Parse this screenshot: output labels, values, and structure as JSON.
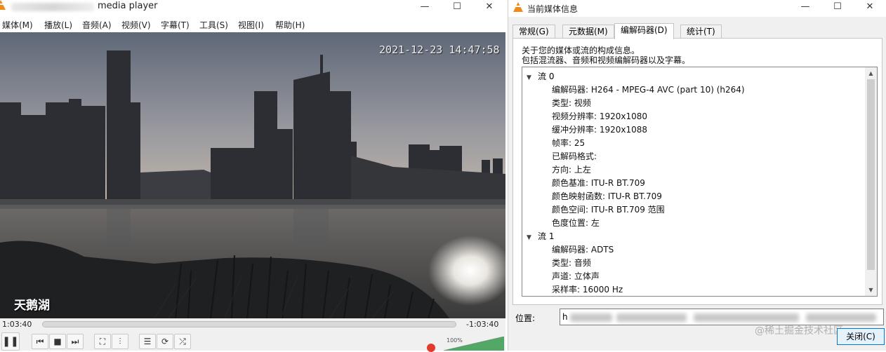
{
  "vlc": {
    "title": "media player",
    "window_controls": {
      "minimize": "—",
      "maximize": "☐",
      "close": "✕"
    },
    "menu": [
      "媒体(M)",
      "播放(L)",
      "音频(A)",
      "视频(V)",
      "字幕(T)",
      "工具(S)",
      "视图(I)",
      "帮助(H)"
    ],
    "video": {
      "timestamp": "2021-12-23 14:47:58",
      "caption": "天鹅湖"
    },
    "time_elapsed": "1:03:40",
    "time_remaining": "-1:03:40",
    "controls": {
      "play": "❚❚",
      "prev": "⏮",
      "stop": "■",
      "next": "⏭",
      "fullscreen": "⛶",
      "extended": "⫶",
      "playlist": "☰",
      "loop": "⟳",
      "random": "⤮"
    },
    "volume_percent": "100%",
    "volume_level": 1.0
  },
  "info": {
    "title": "当前媒体信息",
    "window_controls": {
      "minimize": "—",
      "maximize": "☐",
      "close": "✕"
    },
    "tabs": [
      "常规(G)",
      "元数据(M)",
      "编解码器(D)",
      "统计(T)"
    ],
    "active_tab": "编解码器(D)",
    "description_line1": "关于您的媒体或流的构成信息。",
    "description_line2": "包括混流器、音频和视频编解码器以及字幕。",
    "streams": [
      {
        "name": "流 0",
        "rows": [
          "编解码器: H264 - MPEG-4 AVC (part 10) (h264)",
          "类型: 视频",
          "视频分辨率: 1920x1080",
          "缓冲分辨率: 1920x1088",
          "帧率: 25",
          "已解码格式:",
          "方向: 上左",
          "颜色基准: ITU-R BT.709",
          "颜色映射函数: ITU-R BT.709",
          "颜色空间: ITU-R BT.709 范围",
          "色度位置: 左"
        ]
      },
      {
        "name": "流 1",
        "rows": [
          "编解码器: ADTS",
          "类型: 音频",
          "声道: 立体声",
          "采样率: 16000 Hz"
        ]
      }
    ],
    "location_label": "位置:",
    "location_value": "h",
    "watermark": "@稀土掘金技术社区",
    "close_button": "关闭(C)"
  }
}
